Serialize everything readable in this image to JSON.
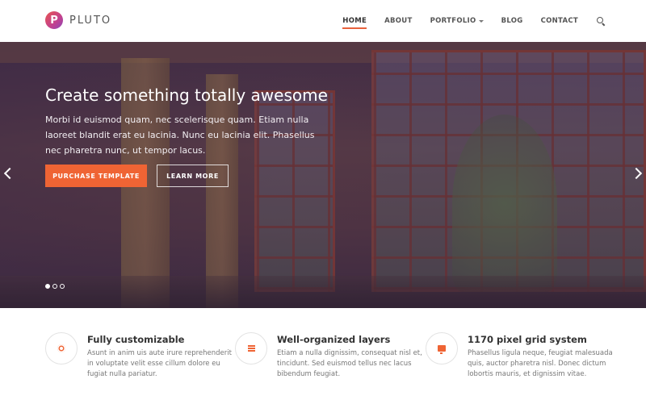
{
  "brand": {
    "logo_letter": "P",
    "name": "PLUTO",
    "accent": "#ef6434"
  },
  "nav": {
    "items": [
      {
        "label": "HOME",
        "active": true
      },
      {
        "label": "ABOUT"
      },
      {
        "label": "PORTFOLIO",
        "dropdown": true
      },
      {
        "label": "BLOG"
      },
      {
        "label": "CONTACT"
      }
    ],
    "search_icon": "search-icon"
  },
  "hero": {
    "title": "Create something totally awesome",
    "description": "Morbi id euismod quam, nec scelerisque quam. Etiam nulla laoreet blandit erat eu lacinia. Nunc eu lacinia elit. Phasellus nec pharetra nunc, ut tempor lacus.",
    "primary_button": "PURCHASE TEMPLATE",
    "secondary_button": "LEARN MORE",
    "slides_total": 3,
    "active_slide": 1
  },
  "features": [
    {
      "icon": "gear-icon",
      "title": "Fully customizable",
      "text": "Asunt in anim uis aute irure reprehenderit in voluptate velit esse cillum dolore eu fugiat nulla pariatur."
    },
    {
      "icon": "layers-icon",
      "title": "Well-organized layers",
      "text": "Etiam a nulla dignissim, consequat nisl et, tincidunt. Sed euismod tellus nec lacus bibendum feugiat."
    },
    {
      "icon": "monitor-icon",
      "title": "1170 pixel grid system",
      "text": "Phasellus ligula neque, feugiat malesuada quis, auctor pharetra nisl. Donec dictum lobortis mauris, et dignissim vitae."
    }
  ]
}
